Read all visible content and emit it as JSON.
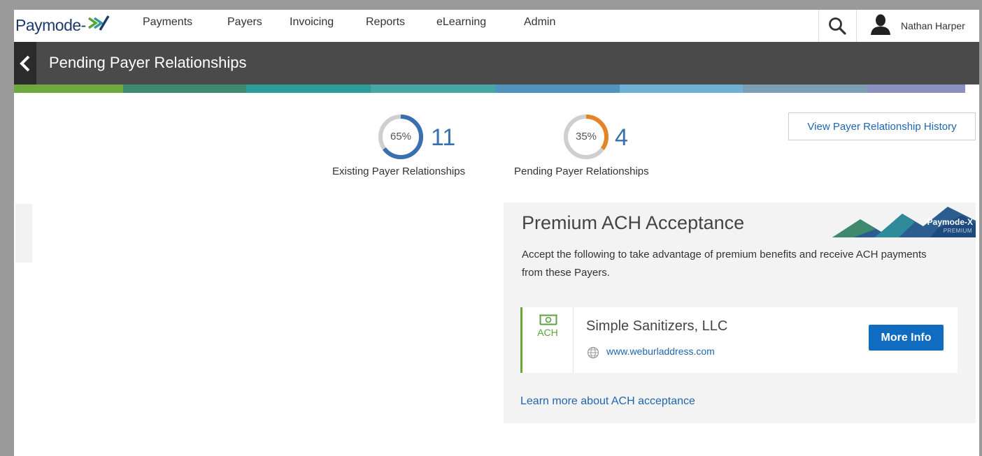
{
  "brand": {
    "logo_text": "Paymode-",
    "logo_x": "X"
  },
  "nav": {
    "items": [
      "Payments",
      "Payers",
      "Invoicing",
      "Reports",
      "eLearning",
      "Admin"
    ],
    "search_icon": "search-icon",
    "user_icon": "user-icon",
    "user_name": "Nathan Harper"
  },
  "header": {
    "title": "Pending Payer Relationships",
    "back_icon": "chevron-left-icon"
  },
  "colors": {
    "strip": [
      "#6ea840",
      "#3f8a6e",
      "#2f9a9a",
      "#45a8a3",
      "#4f94bc",
      "#6fb0d4",
      "#7d9fb5",
      "#8a90c0"
    ],
    "accent_blue": "#3a6fb0",
    "accent_orange": "#e48427",
    "button_blue": "#0f6cc0",
    "ach_green": "#5aa33a"
  },
  "stats": {
    "existing": {
      "percent": 65,
      "percent_label": "65%",
      "count": "11",
      "label": "Existing Payer Relationships"
    },
    "pending": {
      "percent": 35,
      "percent_label": "35%",
      "count": "4",
      "label": "Pending Payer Relationships"
    }
  },
  "history_button": "View Payer Relationship History",
  "premium": {
    "title": "Premium ACH Acceptance",
    "description": "Accept the following to take advantage of premium benefits and receive ACH payments from these Payers.",
    "logo_text": "Paymode-X",
    "logo_sub": "PREMIUM",
    "payer": {
      "ach_label": "ACH",
      "ach_icon": "money-icon",
      "name": "Simple Sanitizers, LLC",
      "url": "www.weburladdress.com",
      "globe_icon": "globe-icon",
      "button": "More Info"
    },
    "learn_more": "Learn more about ACH acceptance"
  }
}
